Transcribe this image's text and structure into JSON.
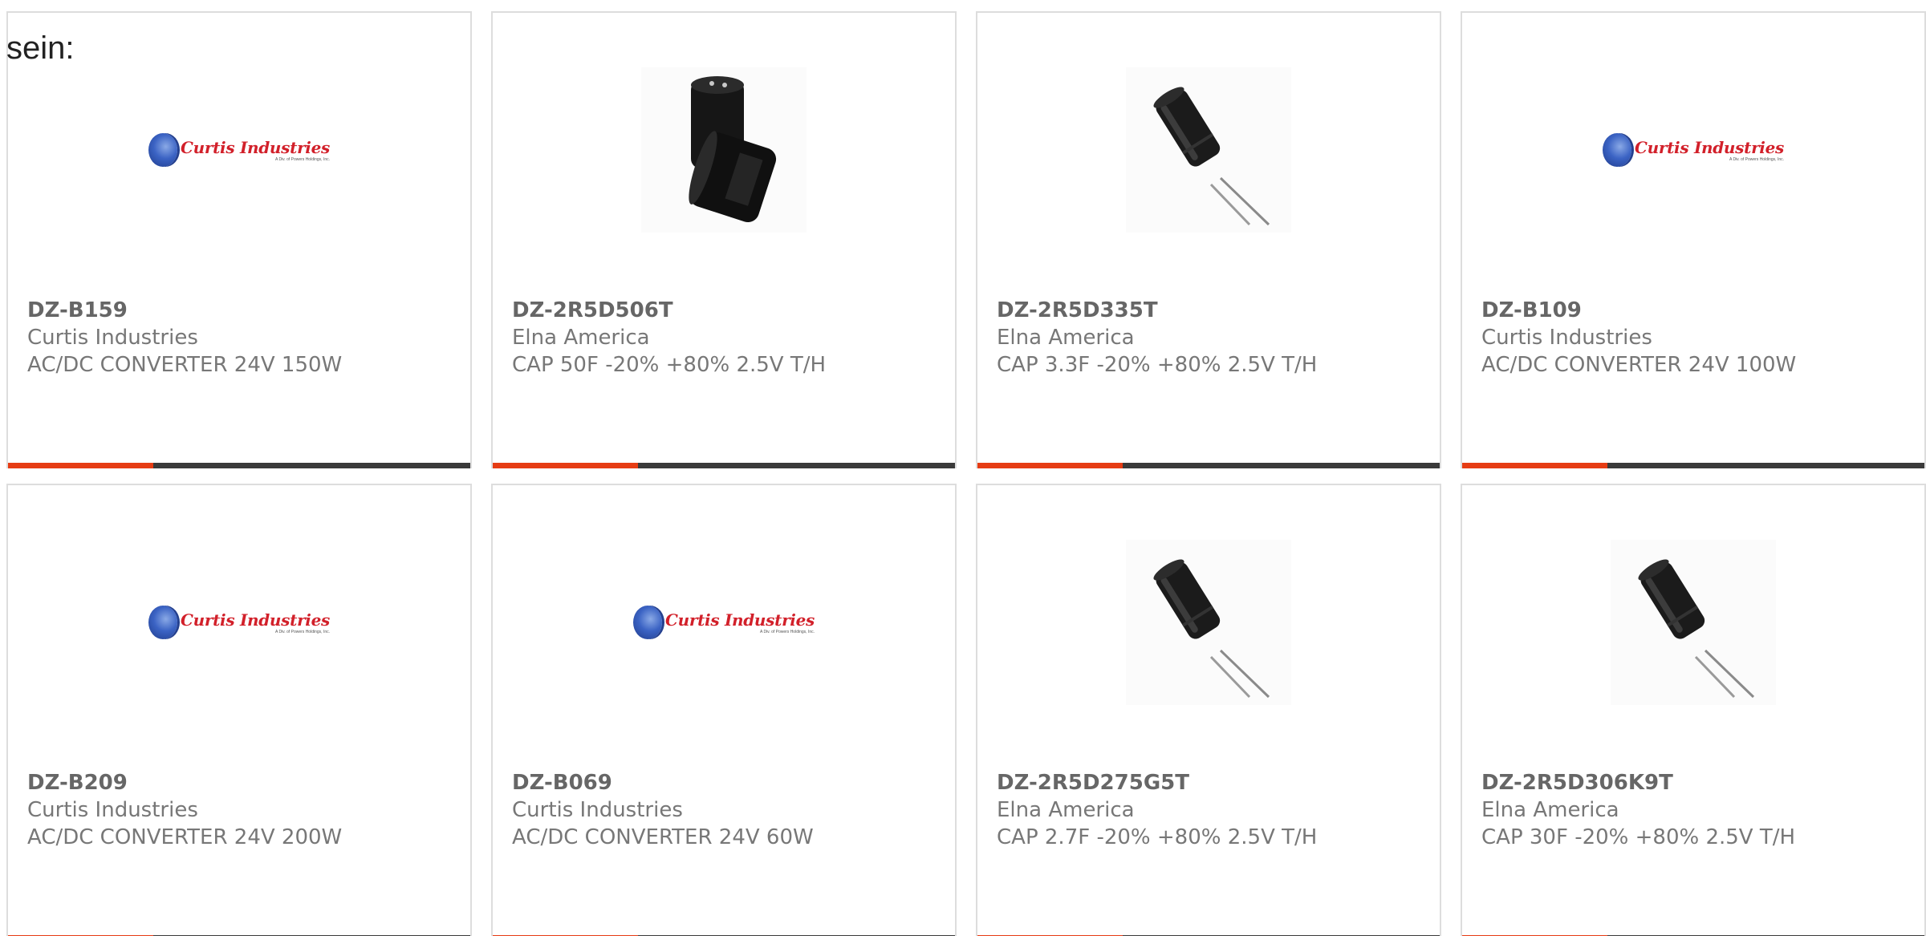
{
  "lead_text": "sein:",
  "colors": {
    "accent": "#e63c14",
    "bar_track": "#3a3a3a",
    "card_border": "#dddddd",
    "text": "#777777"
  },
  "logo": {
    "name": "Curtis Industries",
    "sub": "A Div. of Powers Holdings, Inc."
  },
  "products": [
    {
      "part_number": "DZ-B159",
      "manufacturer": "Curtis Industries",
      "description": "AC/DC CONVERTER 24V 150W",
      "image": "curtis-industries-logo",
      "progress": 0.315
    },
    {
      "part_number": "DZ-2R5D506T",
      "manufacturer": "Elna America",
      "description": "CAP 50F -20% +80% 2.5V T/H",
      "image": "capacitor-pair-photo",
      "progress": 0.315
    },
    {
      "part_number": "DZ-2R5D335T",
      "manufacturer": "Elna America",
      "description": "CAP 3.3F -20% +80% 2.5V T/H",
      "image": "capacitor-photo",
      "progress": 0.315
    },
    {
      "part_number": "DZ-B109",
      "manufacturer": "Curtis Industries",
      "description": "AC/DC CONVERTER 24V 100W",
      "image": "curtis-industries-logo",
      "progress": 0.315
    },
    {
      "part_number": "DZ-B209",
      "manufacturer": "Curtis Industries",
      "description": "AC/DC CONVERTER 24V 200W",
      "image": "curtis-industries-logo",
      "progress": 0.315
    },
    {
      "part_number": "DZ-B069",
      "manufacturer": "Curtis Industries",
      "description": "AC/DC CONVERTER 24V 60W",
      "image": "curtis-industries-logo",
      "progress": 0.315
    },
    {
      "part_number": "DZ-2R5D275G5T",
      "manufacturer": "Elna America",
      "description": "CAP 2.7F -20% +80% 2.5V T/H",
      "image": "capacitor-photo",
      "progress": 0.315
    },
    {
      "part_number": "DZ-2R5D306K9T",
      "manufacturer": "Elna America",
      "description": "CAP 30F -20% +80% 2.5V T/H",
      "image": "capacitor-photo",
      "progress": 0.315
    }
  ]
}
